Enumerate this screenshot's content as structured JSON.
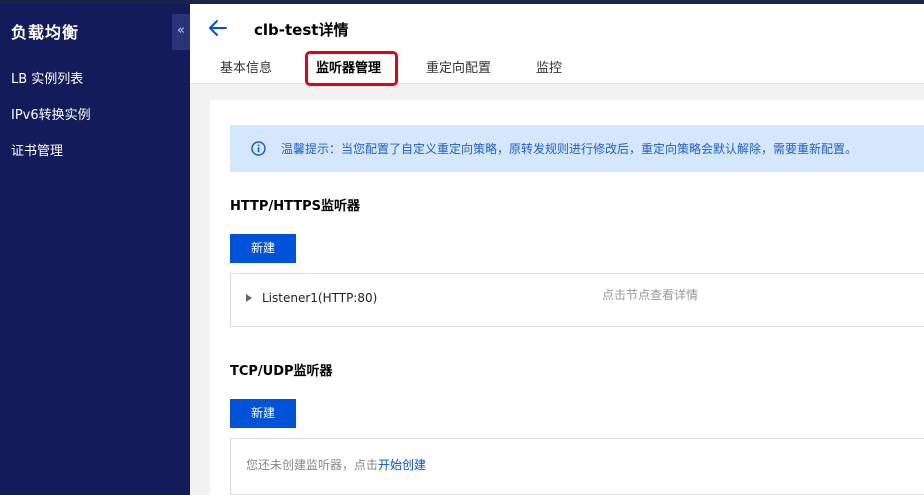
{
  "sidebar": {
    "title": "负载均衡",
    "collapse_glyph": "«",
    "items": [
      {
        "label": "LB 实例列表"
      },
      {
        "label": "IPv6转换实例"
      },
      {
        "label": "证书管理"
      }
    ]
  },
  "header": {
    "title": "clb-test详情",
    "back_icon": "arrow-left-icon",
    "tabs": [
      {
        "label": "基本信息",
        "active": false
      },
      {
        "label": "监听器管理",
        "active": true
      },
      {
        "label": "重定向配置",
        "active": false
      },
      {
        "label": "监控",
        "active": false
      }
    ]
  },
  "notice": {
    "icon": "info-icon",
    "text": "温馨提示：当您配置了自定义重定向策略，原转发规则进行修改后，重定向策略会默认解除，需要重新配置。"
  },
  "http_section": {
    "title": "HTTP/HTTPS监听器",
    "new_button": "新建",
    "listener_label": "Listener1(HTTP:80)",
    "hint": "点击节点查看详情"
  },
  "tcp_section": {
    "title": "TCP/UDP监听器",
    "new_button": "新建",
    "empty_text": "您还未创建监听器，点击",
    "empty_link": "开始创建"
  },
  "colors": {
    "sidebar_bg": "#131b5a",
    "primary": "#0052d9",
    "notice_bg": "#d5e7fd",
    "highlight_border": "#e60012"
  }
}
